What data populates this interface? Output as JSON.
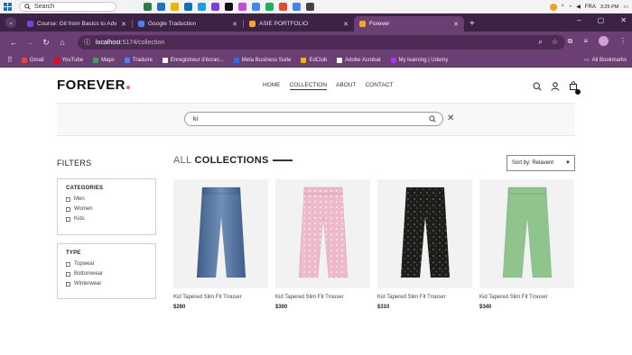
{
  "taskbar": {
    "search_label": "Search",
    "lang": "FRA",
    "time": "3:25 PM",
    "date": "",
    "app_colors": [
      "#2d7d46",
      "#1a73c7",
      "#f2b200",
      "#0b6fc2",
      "#1aa1e5",
      "#7b3fe4",
      "#111111",
      "#c84ad8",
      "#4285f4",
      "#19b25a",
      "#e34b2b",
      "#4285f4",
      "#444444"
    ]
  },
  "tabs": [
    {
      "title": "Course: Git from Basics to Adv",
      "fav_color": "#7b3fe4",
      "active": false
    },
    {
      "title": "Google Traduction",
      "fav_color": "#4285f4",
      "active": false
    },
    {
      "title": "ASIE PORTFOLIO",
      "fav_color": "#f6a623",
      "active": false
    },
    {
      "title": "Forever",
      "fav_color": "#f6a623",
      "active": true
    }
  ],
  "address": {
    "host": "localhost",
    "path": ":5174/collection"
  },
  "bookmarks": [
    {
      "label": "Gmail",
      "color": "#ea4335"
    },
    {
      "label": "YouTube",
      "color": "#ff0000"
    },
    {
      "label": "Maps",
      "color": "#34a853"
    },
    {
      "label": "Traduire",
      "color": "#4285f4"
    },
    {
      "label": "Enregistreur d'écran...",
      "color": "#ffffff"
    },
    {
      "label": "Meta Business Suite",
      "color": "#1877f2"
    },
    {
      "label": "EdClub",
      "color": "#f4b400"
    },
    {
      "label": "Adobe Acrobat",
      "color": "#ffffff"
    },
    {
      "label": "My learning | Udemy",
      "color": "#a435f0"
    }
  ],
  "bookmarks_all": "All Bookmarks",
  "site": {
    "logo": "FOREVER",
    "nav": [
      "HOME",
      "COLLECTION",
      "ABOUT",
      "CONTACT"
    ],
    "search_value": "ki",
    "filters_title": "FILTERS",
    "categories": {
      "title": "CATEGORIES",
      "options": [
        "Men",
        "Women",
        "Kids"
      ]
    },
    "type": {
      "title": "TYPE",
      "options": [
        "Topwear",
        "Bottomwear",
        "Winterwear"
      ]
    },
    "collection_title_1": "ALL",
    "collection_title_2": "COLLECTIONS",
    "sort_label": "Sort by: Relavent",
    "products": [
      {
        "name": "Kid Tapered Slim Fit Trouser",
        "price": "$280",
        "color": "#4e6f9a",
        "pattern": "denim"
      },
      {
        "name": "Kid Tapered Slim Fit Trouser",
        "price": "$300",
        "color": "#f0b9c9",
        "pattern": "pink"
      },
      {
        "name": "Kid Tapered Slim Fit Trouser",
        "price": "$310",
        "color": "#1c1c1c",
        "pattern": "black"
      },
      {
        "name": "Kid Tapered Slim Fit Trouser",
        "price": "$340",
        "color": "#8fc48d",
        "pattern": "green"
      }
    ]
  }
}
